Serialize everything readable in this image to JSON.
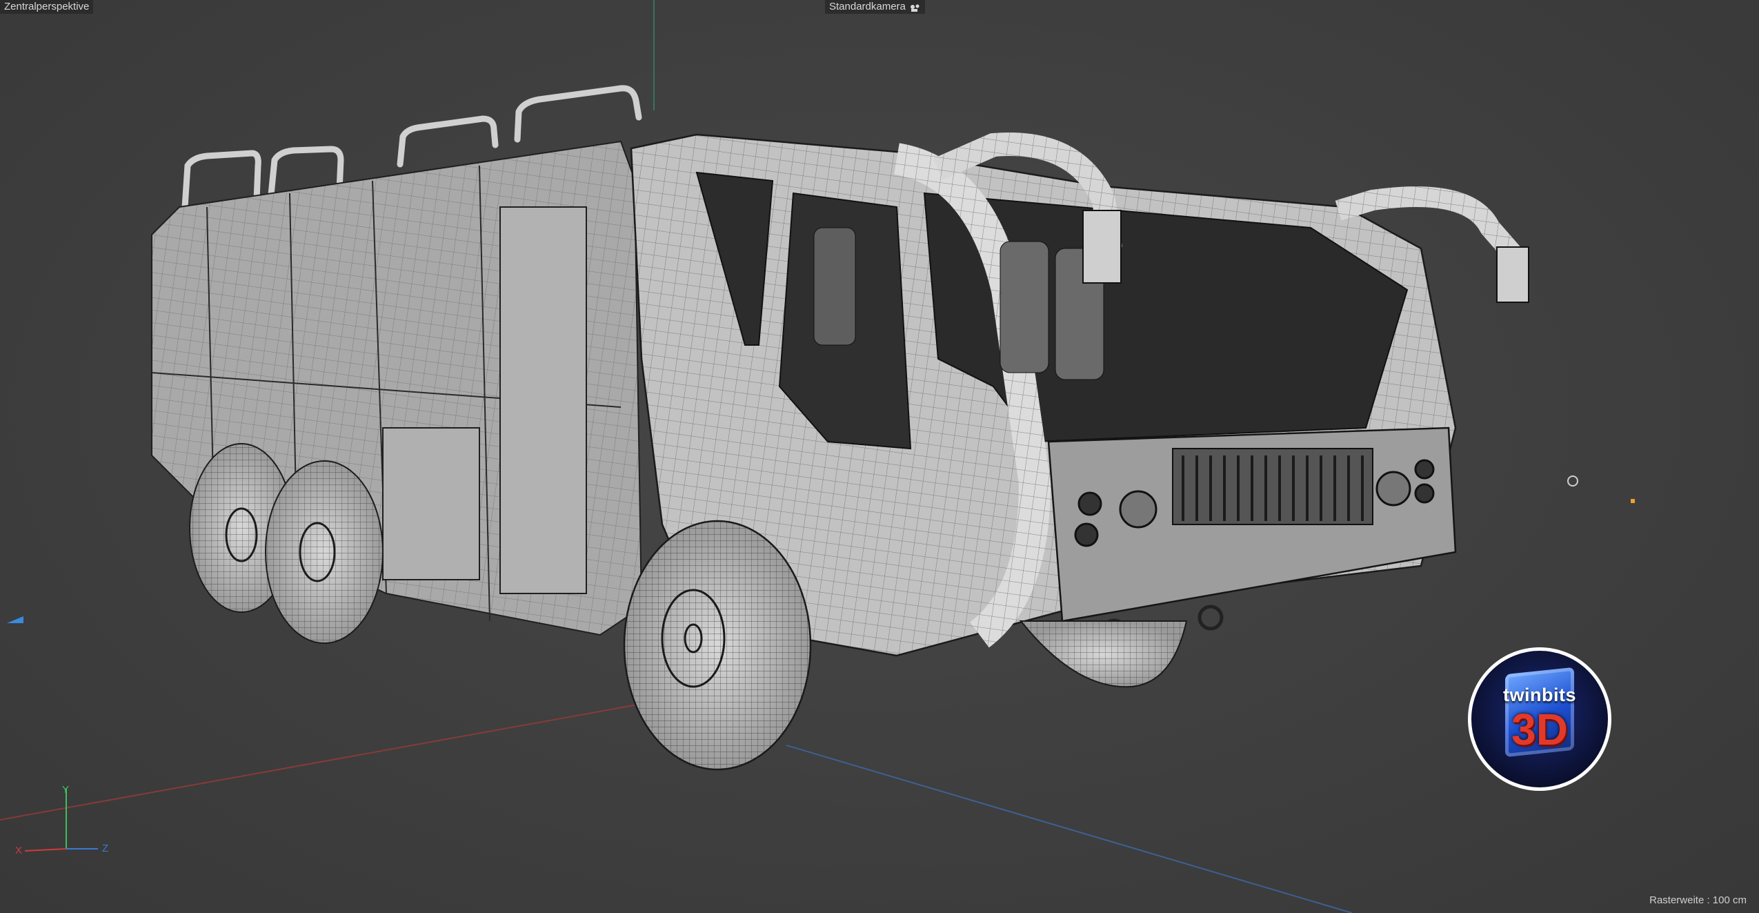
{
  "viewport": {
    "view_label": "Zentralperspektive",
    "camera_label": "Standardkamera",
    "camera_icon": "camera-rig-icon",
    "grid_label": "Rasterweite : 100 cm"
  },
  "axes": {
    "x": "X",
    "y": "Y",
    "z": "Z",
    "colors": {
      "x": "#d03a3a",
      "y": "#3fbf5f",
      "z": "#3a7ad0"
    }
  },
  "logo": {
    "brand": "twinbits",
    "mark": "3D"
  },
  "colors": {
    "background": "#3f3f3f",
    "mesh_fill": "#b8b8b8",
    "wireframe": "#1e1e1e",
    "light_handle": "#f0a030"
  }
}
